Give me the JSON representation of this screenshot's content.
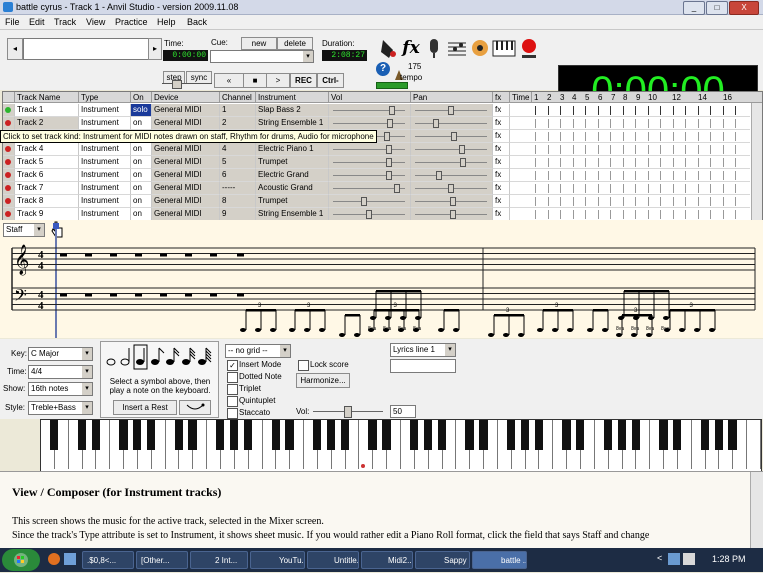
{
  "window": {
    "title": "battle cyrus - Track 1 - Anvil Studio - version 2009.11.08",
    "controls": {
      "minimize": "_",
      "maximize": "□",
      "close": "X"
    }
  },
  "menu": [
    "File",
    "Edit",
    "Track",
    "View",
    "Practice",
    "Help",
    "Back"
  ],
  "toolbar": {
    "time_label": "Time:",
    "time_value": "0:00:00",
    "cue_label": "Cue:",
    "new_label": "new",
    "delete_label": "delete",
    "duration_label": "Duration:",
    "duration_value": "2:08:27",
    "step_label": "step",
    "sync_label": "sync",
    "rew_label": "«",
    "stop_label": "■",
    "play_label": ">",
    "rec_label": "REC",
    "ctrl_label": "Ctrl-",
    "tempo_value": "175",
    "tempo_label": "tempo",
    "fx_label": "fx",
    "help_label": "?",
    "big_time": "0:00:00"
  },
  "grid": {
    "headers": {
      "track_name": "Track Name",
      "type": "Type",
      "on": "On",
      "device": "Device",
      "channel": "Channel",
      "instrument": "Instrument",
      "vol": "Vol",
      "pan": "Pan",
      "fx": "fx",
      "time": "Time"
    },
    "measures": [
      "1",
      "2",
      "3",
      "4",
      "5",
      "6",
      "7",
      "8",
      "9",
      "10",
      "12",
      "14",
      "16"
    ],
    "tracks": [
      {
        "name": "Track 1",
        "type": "Instrument",
        "on": "solo",
        "device": "General MIDI",
        "channel": "1",
        "instrument": "Slap Bass 2",
        "fx": "fx",
        "led": "#2db52d",
        "vol": 0.85,
        "pan": 0.5
      },
      {
        "name": "Track 2",
        "type": "Instrument",
        "on": "on",
        "device": "General MIDI",
        "channel": "2",
        "instrument": "String Ensemble 1",
        "fx": "fx",
        "led": "#cc2222",
        "vol": 0.82,
        "pan": 0.27
      },
      {
        "name": "",
        "type": "",
        "on": "",
        "device": "",
        "channel": "",
        "instrument": "",
        "fx": "fx",
        "led": "#cc2222",
        "vol": 0.78,
        "pan": 0.55
      },
      {
        "name": "Track 4",
        "type": "Instrument",
        "on": "on",
        "device": "General MIDI",
        "channel": "4",
        "instrument": "Electric Piano 1",
        "fx": "fx",
        "led": "#cc2222",
        "vol": 0.8,
        "pan": 0.67
      },
      {
        "name": "Track 5",
        "type": "Instrument",
        "on": "on",
        "device": "General MIDI",
        "channel": "5",
        "instrument": "Trumpet",
        "fx": "fx",
        "led": "#cc2222",
        "vol": 0.8,
        "pan": 0.68
      },
      {
        "name": "Track 6",
        "type": "Instrument",
        "on": "on",
        "device": "General MIDI",
        "channel": "6",
        "instrument": "Electric Grand",
        "fx": "fx",
        "led": "#cc2222",
        "vol": 0.8,
        "pan": 0.32
      },
      {
        "name": "Track 7",
        "type": "Instrument",
        "on": "on",
        "device": "General MIDI",
        "channel": "-----",
        "instrument": "Acoustic Grand",
        "fx": "fx",
        "led": "#cc2222",
        "vol": 0.93,
        "pan": 0.5
      },
      {
        "name": "Track 8",
        "type": "Instrument",
        "on": "on",
        "device": "General MIDI",
        "channel": "8",
        "instrument": "Trumpet",
        "fx": "fx",
        "led": "#cc2222",
        "vol": 0.43,
        "pan": 0.53
      },
      {
        "name": "Track 9",
        "type": "Instrument",
        "on": "on",
        "device": "General MIDI",
        "channel": "9",
        "instrument": "String Ensemble 1",
        "fx": "fx",
        "led": "#cc2222",
        "vol": 0.5,
        "pan": 0.53
      }
    ],
    "tooltip": "Click to set track kind: Instrument for MIDI notes drawn on staff, Rhythm for drums, Audio for microphone"
  },
  "staff": {
    "view_select": "Staff",
    "time_sig_top": "4",
    "time_sig_bottom": "4",
    "triplet_mark": "3",
    "flat_label": "8va"
  },
  "composer": {
    "key_label": "Key:",
    "key_value": "C Major",
    "time_label": "Time:",
    "time_value": "4/4",
    "show_label": "Show:",
    "show_value": "16th notes",
    "style_label": "Style:",
    "style_value": "Treble+Bass",
    "hint_text": "Select a symbol above, then play a note on the keyboard.",
    "insert_rest": "Insert a Rest",
    "grid_select": "-- no grid --",
    "insert_mode": "Insert Mode",
    "dotted_note": "Dotted Note",
    "triplet": "Triplet",
    "quintuplet": "Quintuplet",
    "staccato": "Staccato",
    "lock_score": "Lock score",
    "harmonize": "Harmonize...",
    "lyrics_select": "Lyrics line 1",
    "vol_label": "Vol:",
    "vol_value": "50"
  },
  "help": {
    "heading": "View / Composer (for Instrument tracks)",
    "para1": "This screen shows the music for the active track, selected in the Mixer screen.",
    "para2": "Since the track's Type attribute is set to Instrument, it shows sheet music. If you would rather edit a Piano Roll format, click the field that says Staff and change"
  },
  "taskbar": {
    "items": [
      ".$0,8<...",
      "[Other...",
      "2 Int...",
      "YouTu...",
      "Untitle...",
      "Midi2...",
      "Sappy",
      "battle ..."
    ],
    "clock": "1:28 PM",
    "tray_back": "<"
  }
}
